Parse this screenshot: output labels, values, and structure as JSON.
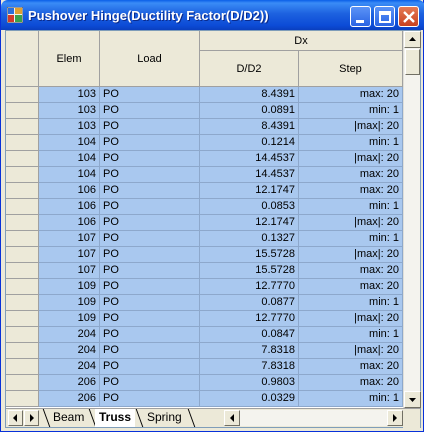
{
  "window": {
    "title": "Pushover Hinge(Ductility Factor(D/D2))"
  },
  "table": {
    "col_elem": "Elem",
    "col_load": "Load",
    "group_dx": "Dx",
    "col_dd2": "D/D2",
    "col_step": "Step",
    "rows": [
      {
        "elem": "103",
        "load": "PO",
        "dd2": "8.4391",
        "step": "max: 20"
      },
      {
        "elem": "103",
        "load": "PO",
        "dd2": "0.0891",
        "step": "min: 1"
      },
      {
        "elem": "103",
        "load": "PO",
        "dd2": "8.4391",
        "step": "|max|: 20"
      },
      {
        "elem": "104",
        "load": "PO",
        "dd2": "0.1214",
        "step": "min: 1"
      },
      {
        "elem": "104",
        "load": "PO",
        "dd2": "14.4537",
        "step": "|max|: 20"
      },
      {
        "elem": "104",
        "load": "PO",
        "dd2": "14.4537",
        "step": "max: 20"
      },
      {
        "elem": "106",
        "load": "PO",
        "dd2": "12.1747",
        "step": "max: 20"
      },
      {
        "elem": "106",
        "load": "PO",
        "dd2": "0.0853",
        "step": "min: 1"
      },
      {
        "elem": "106",
        "load": "PO",
        "dd2": "12.1747",
        "step": "|max|: 20"
      },
      {
        "elem": "107",
        "load": "PO",
        "dd2": "0.1327",
        "step": "min: 1"
      },
      {
        "elem": "107",
        "load": "PO",
        "dd2": "15.5728",
        "step": "|max|: 20"
      },
      {
        "elem": "107",
        "load": "PO",
        "dd2": "15.5728",
        "step": "max: 20"
      },
      {
        "elem": "109",
        "load": "PO",
        "dd2": "12.7770",
        "step": "max: 20"
      },
      {
        "elem": "109",
        "load": "PO",
        "dd2": "0.0877",
        "step": "min: 1"
      },
      {
        "elem": "109",
        "load": "PO",
        "dd2": "12.7770",
        "step": "|max|: 20"
      },
      {
        "elem": "204",
        "load": "PO",
        "dd2": "0.0847",
        "step": "min: 1"
      },
      {
        "elem": "204",
        "load": "PO",
        "dd2": "7.8318",
        "step": "|max|: 20"
      },
      {
        "elem": "204",
        "load": "PO",
        "dd2": "7.8318",
        "step": "max: 20"
      },
      {
        "elem": "206",
        "load": "PO",
        "dd2": "0.9803",
        "step": "max: 20"
      },
      {
        "elem": "206",
        "load": "PO",
        "dd2": "0.0329",
        "step": "min: 1"
      }
    ]
  },
  "tabs": [
    {
      "label": "Beam",
      "active": false
    },
    {
      "label": "Truss",
      "active": true
    },
    {
      "label": "Spring",
      "active": false
    }
  ],
  "colors": {
    "selection": "#a9c8ef",
    "titlebar": "#0a5ee7",
    "close_button": "#c84120"
  }
}
